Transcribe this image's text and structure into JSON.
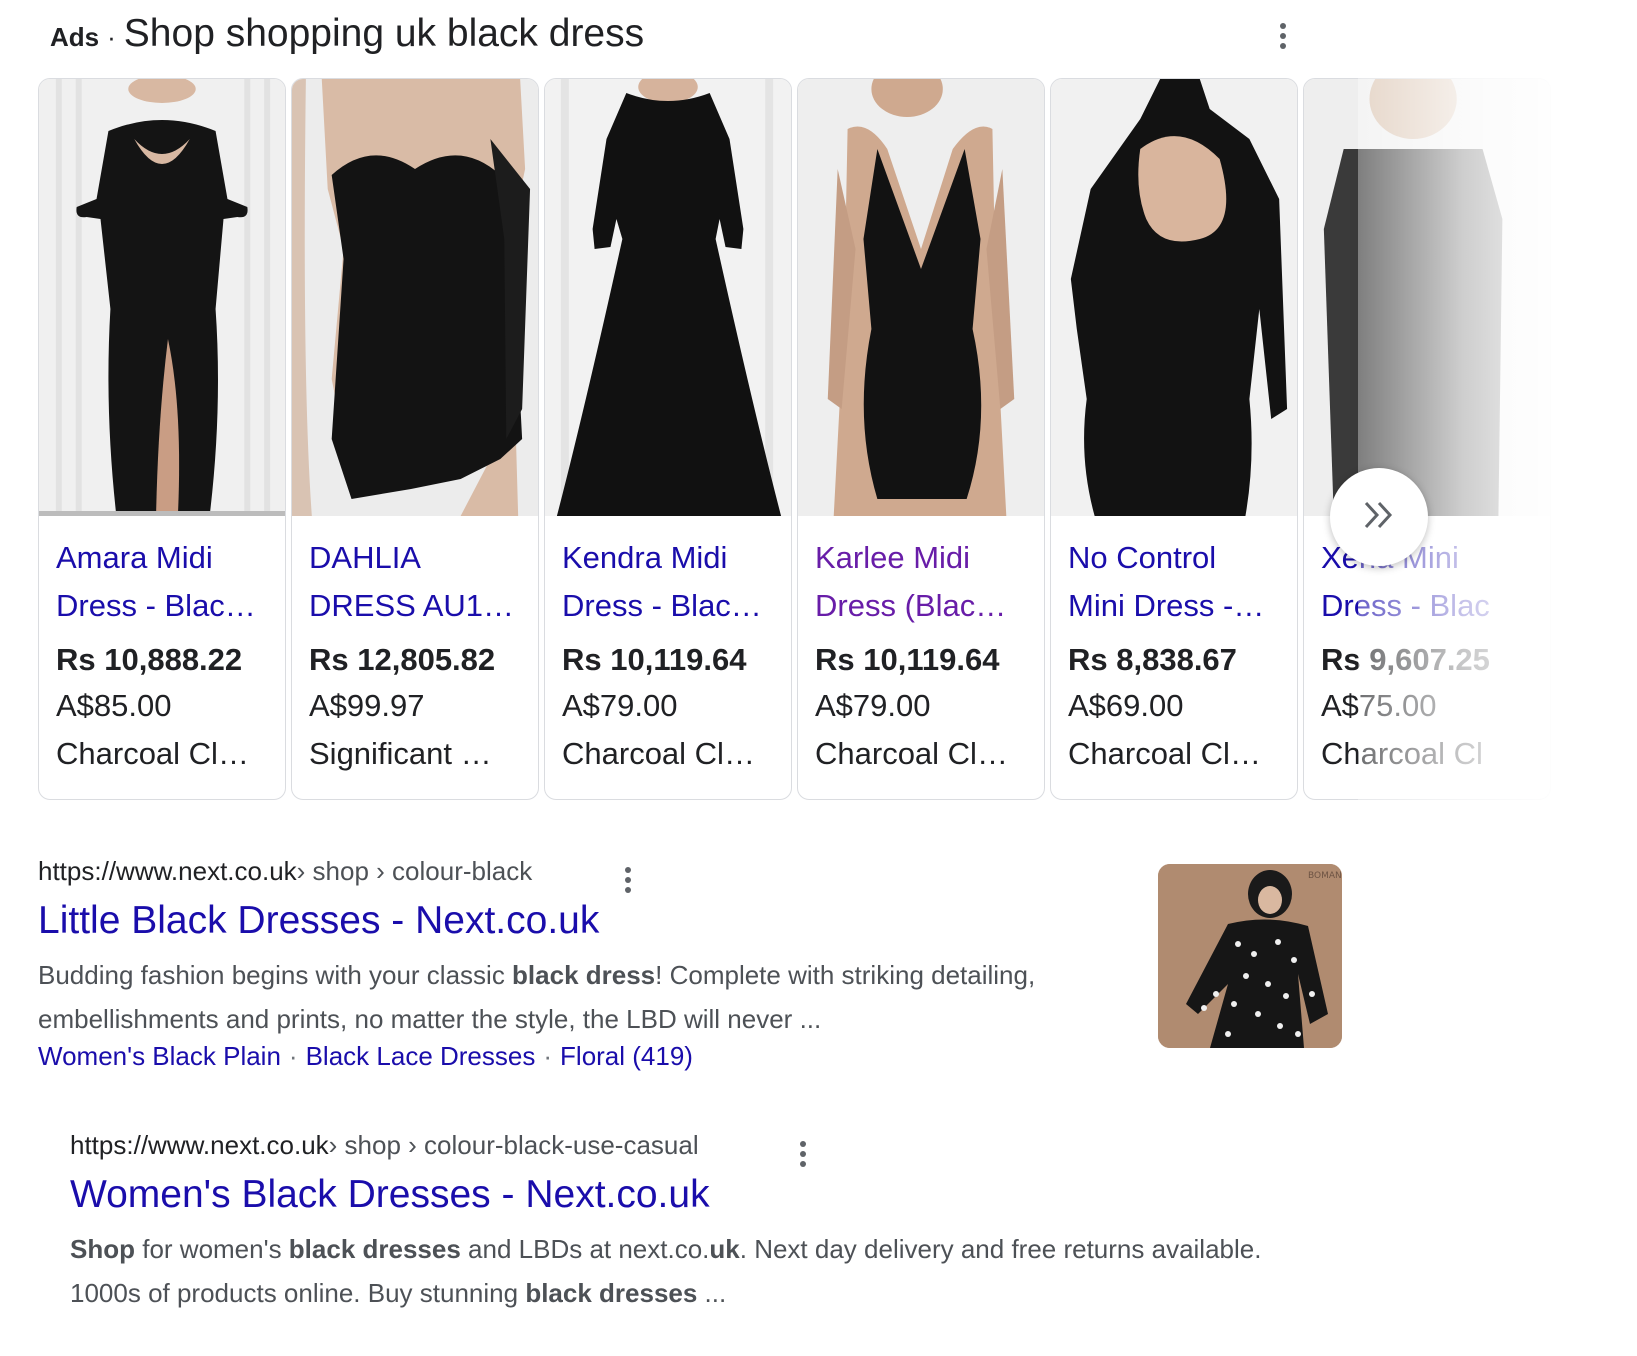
{
  "ads": {
    "label": "Ads",
    "separator": "·",
    "title": "Shop shopping uk black dress",
    "menu_icon": "more-vert-icon"
  },
  "products": [
    {
      "title_line1": "Amara Midi",
      "title_line2": "Dress - Blac…",
      "price": "Rs 10,888.22",
      "original_price": "A$85.00",
      "merchant": "Charcoal Cl…",
      "visited": false
    },
    {
      "title_line1": "DAHLIA",
      "title_line2": "DRESS AU1…",
      "price": "Rs 12,805.82",
      "original_price": "A$99.97",
      "merchant": "Significant …",
      "visited": false
    },
    {
      "title_line1": "Kendra Midi",
      "title_line2": "Dress - Blac…",
      "price": "Rs 10,119.64",
      "original_price": "A$79.00",
      "merchant": "Charcoal Cl…",
      "visited": false
    },
    {
      "title_line1": "Karlee Midi",
      "title_line2": "Dress (Blac…",
      "price": "Rs 10,119.64",
      "original_price": "A$79.00",
      "merchant": "Charcoal Cl…",
      "visited": true
    },
    {
      "title_line1": "No Control",
      "title_line2": "Mini Dress -…",
      "price": "Rs 8,838.67",
      "original_price": "A$69.00",
      "merchant": "Charcoal Cl…",
      "visited": false
    },
    {
      "title_line1": "Xena Mini",
      "title_line2": "Dress - Blac",
      "price": "Rs 9,607.25",
      "original_price": "A$75.00",
      "merchant": "Charcoal Cl",
      "visited": false
    }
  ],
  "carousel": {
    "next_icon": "double-chevron-right-icon"
  },
  "results": [
    {
      "domain": "https://www.next.co.uk",
      "path": " › shop › colour-black",
      "title": "Little Black Dresses - Next.co.uk",
      "snippet_1": "Budding fashion begins with your classic ",
      "snippet_b1": "black dress",
      "snippet_2": "! Complete with striking detailing, embellishments and prints, no matter the style, the LBD will never ...",
      "sitelinks": [
        "Women's Black Plain",
        "Black Lace Dresses",
        "Floral (419)"
      ],
      "sitelink_separator": "·",
      "thumb_text": "BOMAN"
    },
    {
      "domain": "https://www.next.co.uk",
      "path": " › shop › colour-black-use-casual",
      "title": "Women's Black Dresses - Next.co.uk",
      "s_b1": "Shop",
      "s_1": " for women's ",
      "s_b2": "black dresses",
      "s_2": " and LBDs at next.co.",
      "s_b3": "uk",
      "s_3": ". Next day delivery and free returns available. 1000s of products online. Buy stunning ",
      "s_b4": "black dresses",
      "s_4": " ..."
    }
  ]
}
